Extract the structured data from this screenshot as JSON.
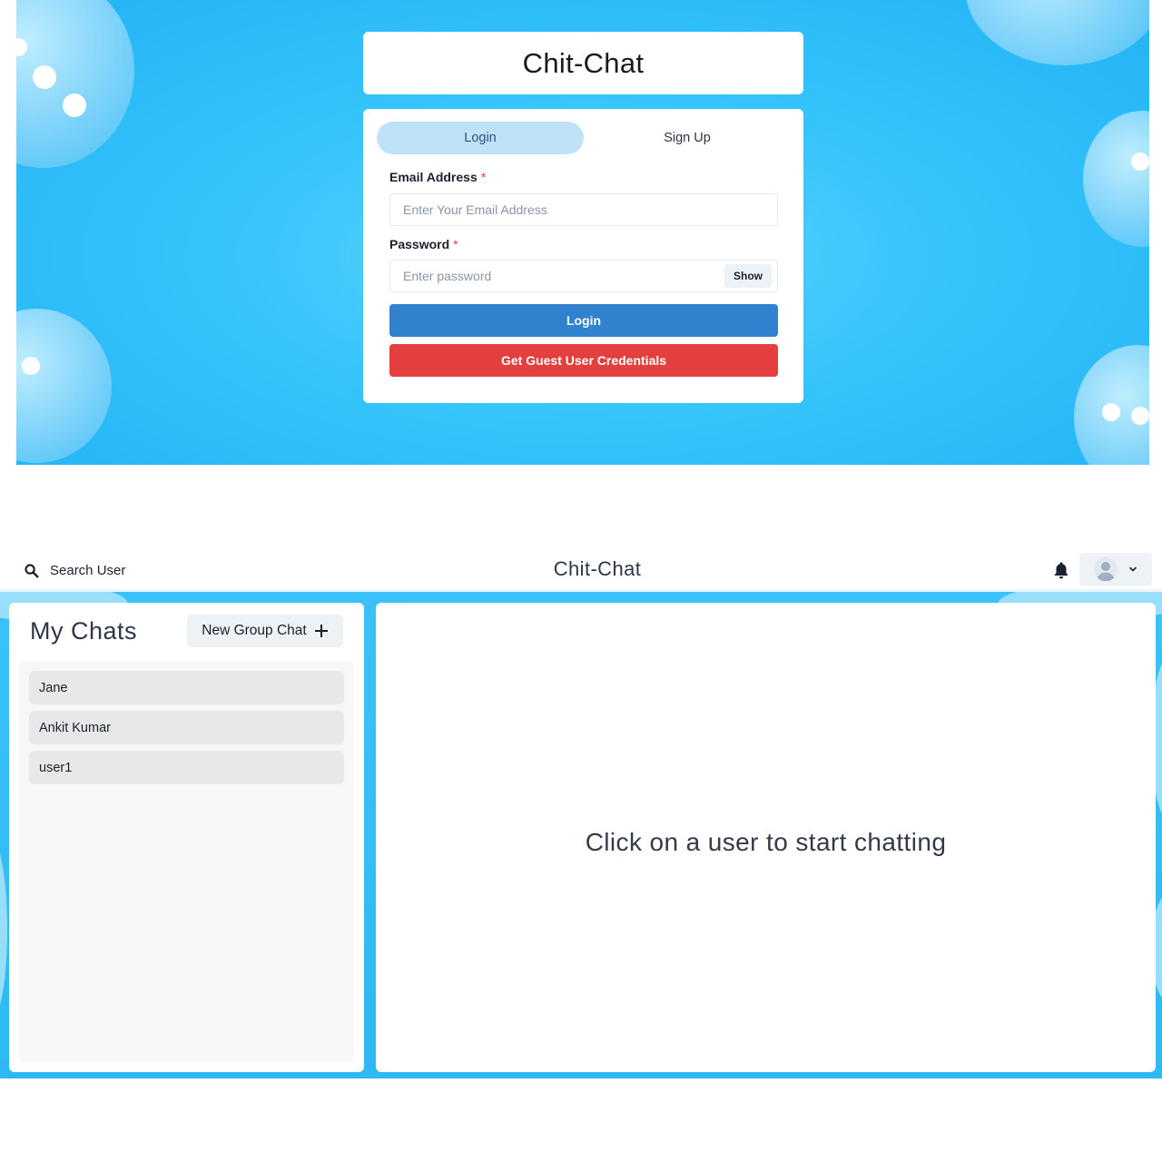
{
  "login": {
    "title": "Chit-Chat",
    "tabs": [
      {
        "label": "Login",
        "active": true
      },
      {
        "label": "Sign Up",
        "active": false
      }
    ],
    "email": {
      "label": "Email Address",
      "required_mark": "*",
      "placeholder": "Enter Your Email Address",
      "value": ""
    },
    "password": {
      "label": "Password",
      "required_mark": "*",
      "placeholder": "Enter password",
      "value": "",
      "toggle_label": "Show"
    },
    "login_button": "Login",
    "guest_button": "Get Guest User Credentials"
  },
  "chat": {
    "header": {
      "search_label": "Search User",
      "app_title": "Chit-Chat",
      "icons": [
        "search-icon",
        "bell-icon",
        "avatar",
        "chevron-down-icon"
      ]
    },
    "sidebar": {
      "title": "My Chats",
      "new_group_label": "New Group Chat",
      "chats": [
        {
          "name": "Jane"
        },
        {
          "name": "Ankit Kumar"
        },
        {
          "name": "user1"
        }
      ]
    },
    "empty_state": "Click on a user to start chatting"
  },
  "colors": {
    "primary": "#3182ce",
    "danger": "#e53e3e",
    "tab_active": "#bee3f8",
    "background_blue": "#35c4fb"
  }
}
